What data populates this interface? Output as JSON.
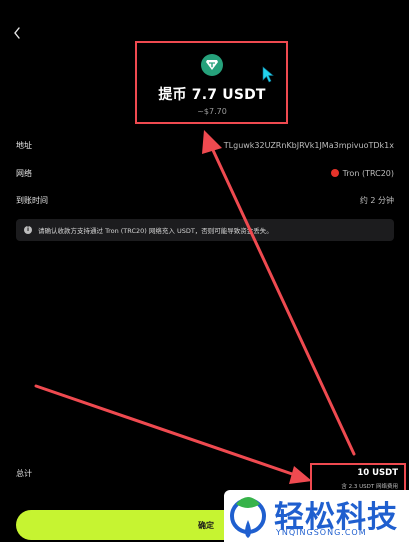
{
  "nav": {
    "back_icon": "chevron-left-icon"
  },
  "header": {
    "token_icon": "tether-usdt-icon",
    "title": "提币 7.7 USDT",
    "subtitle": "~$7.70"
  },
  "details": [
    {
      "label": "地址",
      "value": "TLguwk32UZRnKbJRVk1JMa3mpivuoTDk1x"
    },
    {
      "label": "网络",
      "value": "Tron (TRC20)",
      "icon": "tron-icon"
    },
    {
      "label": "到账时间",
      "value": "约 2 分钟"
    }
  ],
  "notice": {
    "icon": "info-icon",
    "text": "请确认收款方支持通过 Tron (TRC20) 网络充入 USDT，否则可能导致资金丢失。"
  },
  "total": {
    "label": "总计",
    "amount": "10 USDT",
    "fee": "含 2.3 USDT 网络费用"
  },
  "confirm_label": "确定",
  "watermark": {
    "text": "轻松科技",
    "sub": "YNQINGSONG.COM"
  },
  "colors": {
    "background": "#000000",
    "accent_button": "#c6f431",
    "annotation_red": "#ef4a50",
    "tether_green": "#26a17b",
    "tron_red": "#e5332a",
    "cursor": "#22d3ee",
    "watermark_blue": "#1f5fcf"
  }
}
